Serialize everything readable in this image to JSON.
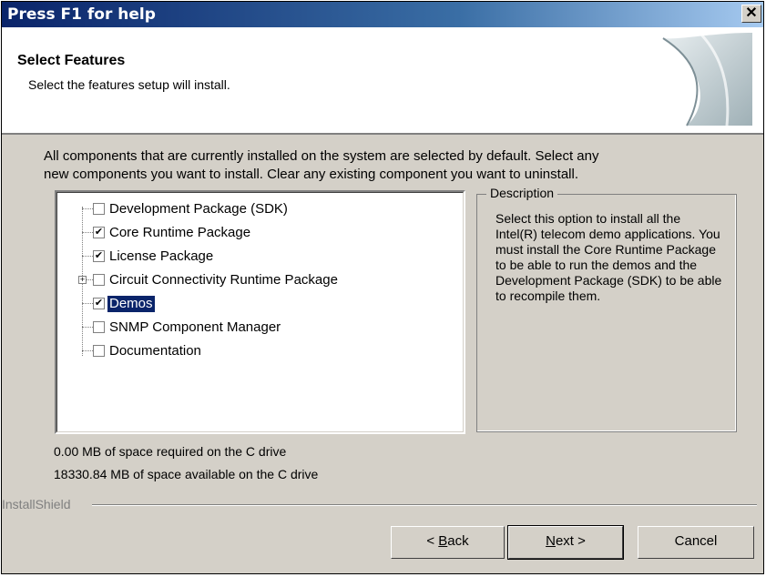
{
  "window": {
    "title": "Press F1 for help",
    "close_glyph": "✕"
  },
  "header": {
    "title": "Select Features",
    "subtitle": "Select the features setup will install."
  },
  "intro": {
    "line1": "All components that are currently installed on the system are selected by default.  Select any",
    "line2": "new components you want to install.  Clear any existing component you want to uninstall."
  },
  "features": [
    {
      "label": "Development Package (SDK)",
      "checked": false,
      "expandable": false,
      "selected": false
    },
    {
      "label": "Core Runtime Package",
      "checked": true,
      "expandable": false,
      "selected": false
    },
    {
      "label": "License Package",
      "checked": true,
      "expandable": false,
      "selected": false
    },
    {
      "label": "Circuit Connectivity Runtime Package",
      "checked": false,
      "expandable": true,
      "selected": false
    },
    {
      "label": "Demos",
      "checked": true,
      "expandable": false,
      "selected": true
    },
    {
      "label": "SNMP Component Manager",
      "checked": false,
      "expandable": false,
      "selected": false
    },
    {
      "label": "Documentation",
      "checked": false,
      "expandable": false,
      "selected": false
    }
  ],
  "description": {
    "legend": "Description",
    "text": "Select this option to install all the Intel(R) telecom demo applications. You must install the Core Runtime Package to be able to run the demos and the Development Package (SDK) to be able to recompile them."
  },
  "space": {
    "required": "0.00 MB of space required on the C drive",
    "available": "18330.84 MB of space available on the C drive"
  },
  "footer": {
    "brand": "InstallShield"
  },
  "buttons": {
    "back": {
      "prefix": "< ",
      "accel": "B",
      "rest": "ack"
    },
    "next": {
      "accel": "N",
      "rest": "ext >"
    },
    "cancel": {
      "label": "Cancel"
    }
  },
  "colors": {
    "titlebar_start": "#0a246a",
    "dialog_face": "#d4d0c8",
    "selection": "#0a246a"
  },
  "icons": {
    "checkmark": "✔",
    "expand": "+",
    "close": "✕"
  }
}
